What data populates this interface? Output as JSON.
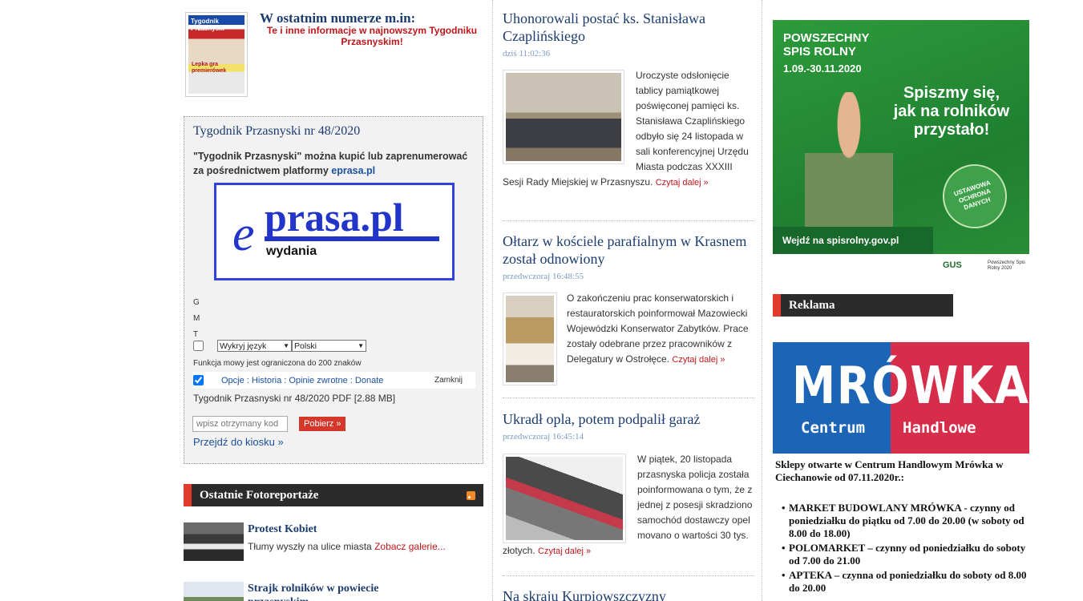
{
  "left": {
    "magazine": {
      "cover_title": "Tygodnik Przasnyski",
      "cover_headline": "Lepka gra premierówek",
      "heading": "W ostatnim numerze m.in:",
      "subheading": "Te i inne informacje w najnowszym Tygodniku Przasnyskim!"
    },
    "tygodnik": {
      "title": "Tygodnik Przasnyski nr 48/2020",
      "desc": "\"Tygodnik Przasnyski\" można kupić lub zaprenumerować za pośrednictwem platformy ",
      "desc_link": "eprasa.pl",
      "logo_e": "e",
      "logo_prasa": "prasa.pl",
      "logo_wydania": "wydania",
      "gmt": [
        "G",
        "M",
        "T"
      ],
      "select_source": "Wykryj język",
      "select_target": "Polski",
      "speech_note": "Funkcja mowy jest ograniczona do 200 znaków",
      "options_links": "Opcje : Historia : Opinie zwrotne : Donate",
      "close_label": "Zamknij",
      "pdf_label": "Tygodnik Przasnyski nr 48/2020 PDF [2.88 MB]",
      "code_placeholder": "wpisz otrzymany kod",
      "download_label": "Pobierz »",
      "kiosk_label": "Przejdź do kiosku »"
    },
    "photoreports": {
      "header": "Ostatnie Fotoreportaże",
      "items": [
        {
          "title": "Protest Kobiet",
          "desc": "Tłumy wyszły na ulice miasta",
          "more": "Zobacz galerie..."
        },
        {
          "title": "Strajk rolników w powiecie przasnyskim",
          "desc": "",
          "more": ""
        }
      ]
    }
  },
  "articles": [
    {
      "title": "Uhonorowali postać ks. Stanisława Czaplińskiego",
      "date": "dziś 11:02:36",
      "text": "Uroczyste odsłonięcie tablicy pamiątkowej poświęconej pamięci ks. Stanisława Czaplińskiego odbyło się 24 listopada w sali konferencyjnej Urzędu Miasta podczas XXXIII Sesji Rady Miejskiej w Przasnyszu.",
      "more": "Czytaj dalej »"
    },
    {
      "title": "Ołtarz w kościele parafialnym w Krasnem został odnowiony",
      "date": "przedwczoraj 16:48:55",
      "text": "O zakończeniu prac konserwatorskich i restauratorskich poinformował Mazowiecki Wojewódzki Konserwator Zabytków. Prace zostały odebrane przez pracowników z Delegatury w Ostrołęce.",
      "more": "Czytaj dalej »"
    },
    {
      "title": "Ukradł opla, potem podpalił garaż",
      "date": "przedwczoraj 16:45:14",
      "text": "W piątek, 20 listopada przasnyska policja została poinformowana o tym, że z jednej z posesji skradziono samochód dostawczy opel movano o wartości 30 tys. złotych.",
      "more": "Czytaj dalej »"
    },
    {
      "title": "Na skraju Kurpiowszczyzny",
      "date": "",
      "text": "",
      "more": ""
    }
  ],
  "right": {
    "spis": {
      "line1": "POWSZECHNY",
      "line2": "SPIS ROLNY",
      "dates": "1.09.-30.11.2020",
      "slogan": "Spiszmy się, jak na rolników przystało!",
      "stamp": "USTAWOWA OCHRONA DANYCH",
      "url_prefix": "Wejdź na ",
      "url": "spisrolny.gov.pl",
      "gus": "GUS",
      "gus_sub": "Powszechny Spis Rolny 2020"
    },
    "reklama_header": "Reklama",
    "mrowka": {
      "name": "MRÓWKA",
      "sub_left": "Centrum",
      "sub_right": "Handlowe"
    },
    "shops": {
      "intro": "Sklepy otwarte w Centrum Handlowym Mrówka w Ciechanowie od 07.11.2020r.:",
      "items": [
        "MARKET BUDOWLANY MRÓWKA - czynny od poniedziałku do piątku od 7.00 do 20.00 (w soboty od 8.00 do 18.00)",
        "POLOMARKET – czynny od poniedziałku do soboty od 7.00 do 21.00",
        "APTEKA – czynna od poniedziałku do soboty od 8.00 do 20.00"
      ]
    }
  },
  "colors": {
    "link_blue": "#1c3c6e",
    "accent_red": "#e23b2c",
    "header_dark": "#2b2b2b"
  }
}
